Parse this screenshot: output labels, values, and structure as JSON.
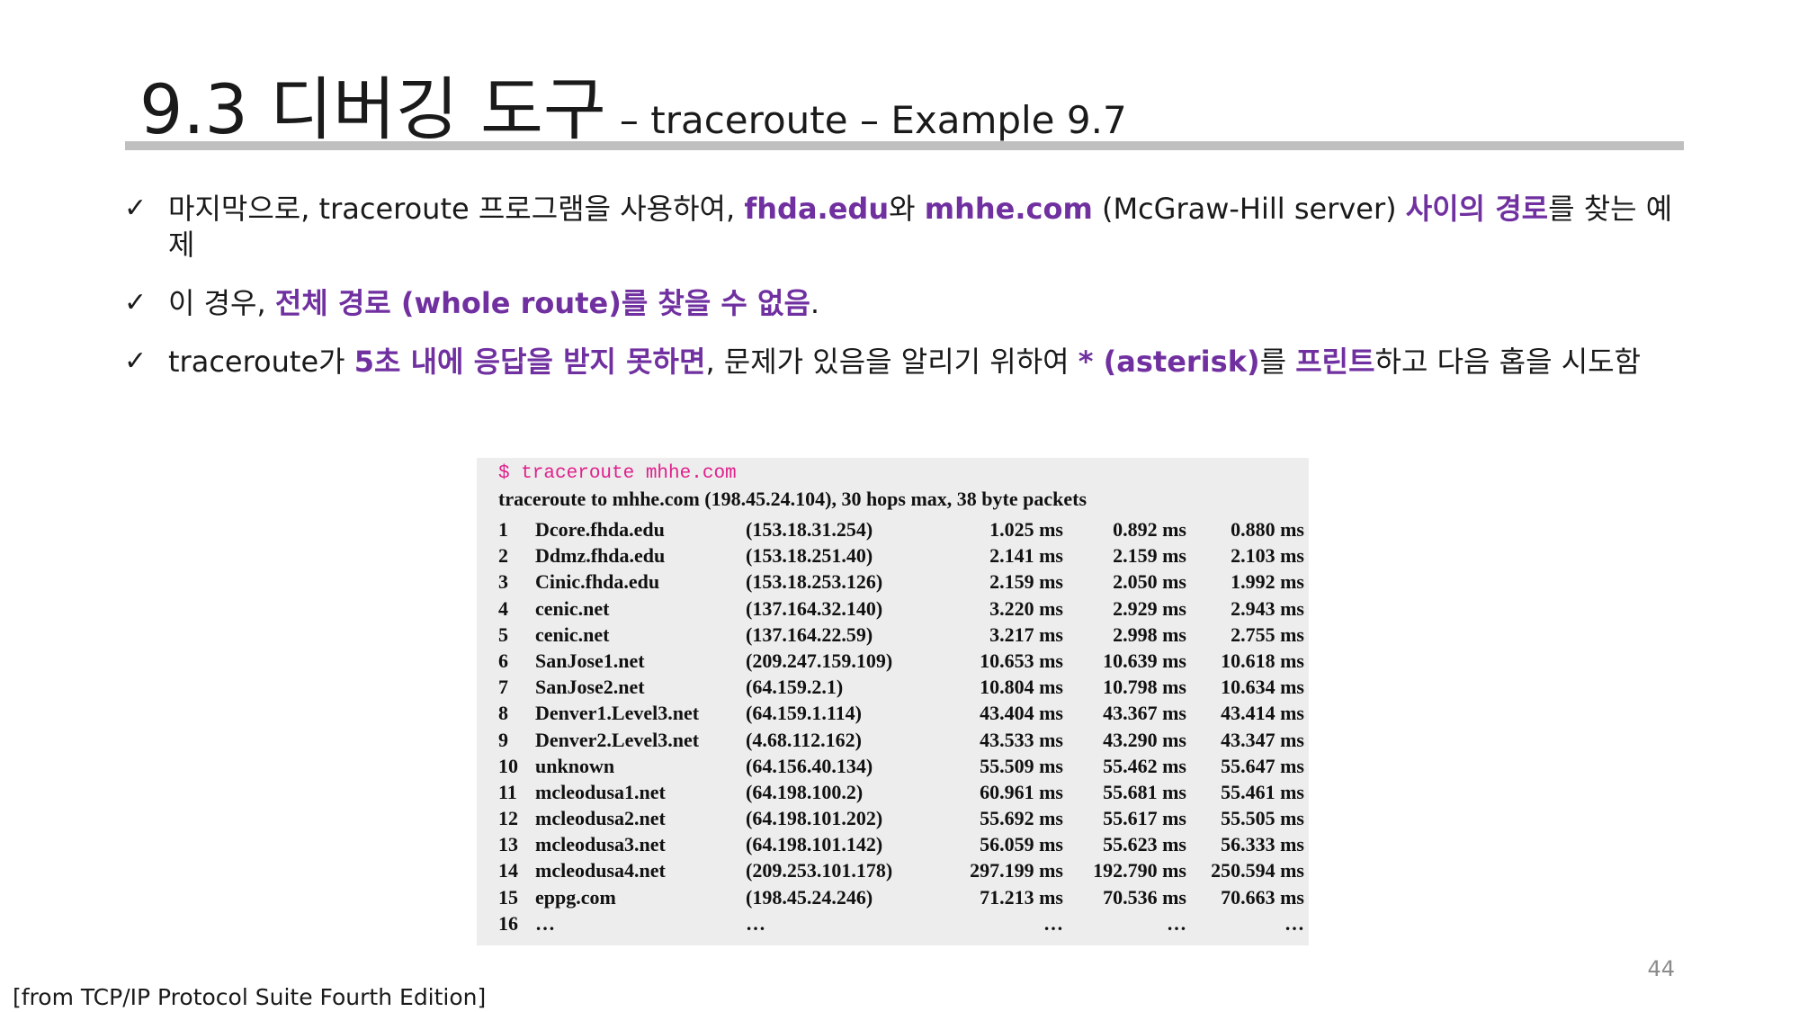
{
  "title": {
    "main": "9.3 디버깅 도구",
    "sub": "– traceroute – Example 9.7"
  },
  "bullets": [
    [
      {
        "t": "마지막으로, traceroute 프로그램을 사용하여, ",
        "h": false
      },
      {
        "t": "fhda.edu",
        "h": true
      },
      {
        "t": "와 ",
        "h": false
      },
      {
        "t": "mhhe.com",
        "h": true
      },
      {
        "t": " (McGraw-Hill server) ",
        "h": false
      },
      {
        "t": "사이의 경로",
        "h": true
      },
      {
        "t": "를 찾는 예제",
        "h": false
      }
    ],
    [
      {
        "t": "이 경우, ",
        "h": false
      },
      {
        "t": "전체 경로 (whole route)를 찾을 수 없음",
        "h": true
      },
      {
        "t": ".",
        "h": false
      }
    ],
    [
      {
        "t": "traceroute가 ",
        "h": false
      },
      {
        "t": "5초 내에 응답을 받지 못하면",
        "h": true
      },
      {
        "t": ", 문제가 있음을 알리기 위하여 ",
        "h": false
      },
      {
        "t": "* (asterisk)",
        "h": true
      },
      {
        "t": "를 ",
        "h": false
      },
      {
        "t": "프린트",
        "h": true
      },
      {
        "t": "하고 다음 홉을 시도함",
        "h": false
      }
    ]
  ],
  "check_symbol": "✓",
  "traceroute": {
    "command": "$ traceroute mhhe.com",
    "header": "traceroute to mhhe.com (198.45.24.104), 30 hops max, 38 byte packets",
    "rows": [
      [
        "1",
        "Dcore.fhda.edu",
        "(153.18.31.254)",
        "1.025 ms",
        "0.892 ms",
        "0.880 ms"
      ],
      [
        "2",
        "Ddmz.fhda.edu",
        "(153.18.251.40)",
        "2.141 ms",
        "2.159 ms",
        "2.103 ms"
      ],
      [
        "3",
        "Cinic.fhda.edu",
        "(153.18.253.126)",
        "2.159 ms",
        "2.050 ms",
        "1.992 ms"
      ],
      [
        "4",
        "cenic.net",
        "(137.164.32.140)",
        "3.220 ms",
        "2.929 ms",
        "2.943 ms"
      ],
      [
        "5",
        "cenic.net",
        "(137.164.22.59)",
        "3.217 ms",
        "2.998 ms",
        "2.755 ms"
      ],
      [
        "6",
        "SanJose1.net",
        "(209.247.159.109)",
        "10.653 ms",
        "10.639 ms",
        "10.618 ms"
      ],
      [
        "7",
        "SanJose2.net",
        "(64.159.2.1)",
        "10.804 ms",
        "10.798 ms",
        "10.634 ms"
      ],
      [
        "8",
        "Denver1.Level3.net",
        "(64.159.1.114)",
        "43.404 ms",
        "43.367 ms",
        "43.414 ms"
      ],
      [
        "9",
        "Denver2.Level3.net",
        "(4.68.112.162)",
        "43.533 ms",
        "43.290 ms",
        "43.347 ms"
      ],
      [
        "10",
        "unknown",
        "(64.156.40.134)",
        "55.509 ms",
        "55.462 ms",
        "55.647 ms"
      ],
      [
        "11",
        "mcleodusa1.net",
        "(64.198.100.2)",
        "60.961 ms",
        "55.681 ms",
        "55.461 ms"
      ],
      [
        "12",
        "mcleodusa2.net",
        "(64.198.101.202)",
        "55.692 ms",
        "55.617 ms",
        "55.505 ms"
      ],
      [
        "13",
        "mcleodusa3.net",
        "(64.198.101.142)",
        "56.059 ms",
        "55.623 ms",
        "56.333 ms"
      ],
      [
        "14",
        "mcleodusa4.net",
        "(209.253.101.178)",
        "297.199 ms",
        "192.790 ms",
        "250.594 ms"
      ],
      [
        "15",
        "eppg.com",
        "(198.45.24.246)",
        "71.213 ms",
        "70.536 ms",
        "70.663 ms"
      ],
      [
        "16",
        "…",
        "…",
        "…",
        "…",
        "…"
      ]
    ]
  },
  "page_number": "44",
  "source": "[from TCP/IP Protocol Suite Fourth Edition]",
  "colors": {
    "highlight": "#7030a0",
    "command": "#e0208c",
    "rule": "#bfbfbf",
    "panel": "#ededed"
  }
}
